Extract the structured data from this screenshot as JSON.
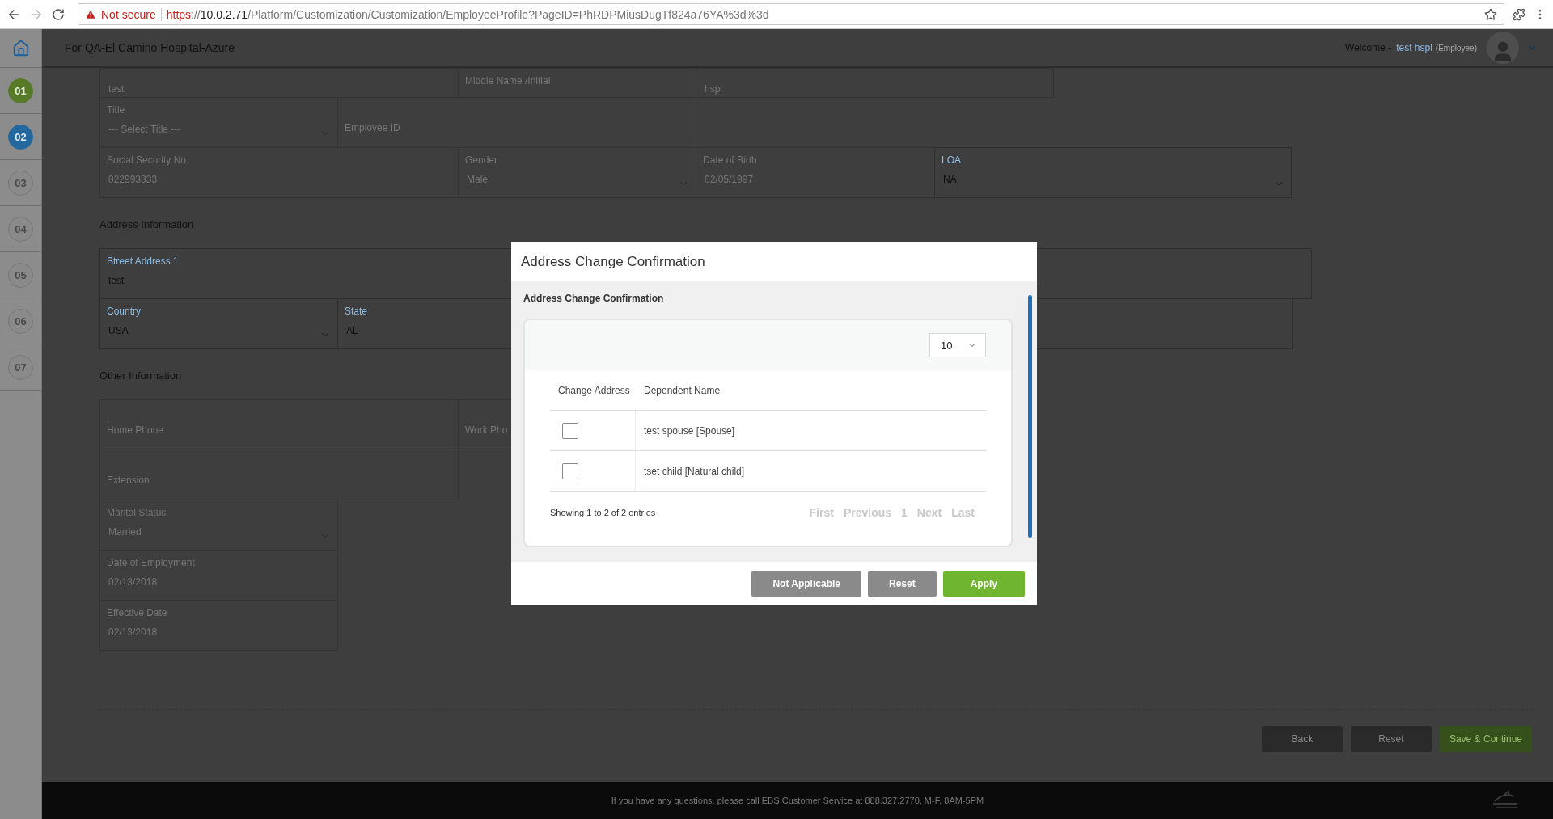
{
  "browser": {
    "security": "Not secure",
    "url_scheme": "https",
    "url_separator": "://",
    "url_host": "10.0.2.71",
    "url_path": "/Platform/Customization/Customization/EmployeeProfile?PageID=PhRDPMiusDugTf824a76YA%3d%3d"
  },
  "header": {
    "title": "For QA-El Camino Hospital-Azure",
    "welcome": "Welcome -",
    "user_name": "test hspl",
    "user_role": "(Employee)"
  },
  "steps": [
    {
      "label": "01",
      "completed": true,
      "selected": false
    },
    {
      "label": "02",
      "completed": false,
      "selected": true
    },
    {
      "label": "03",
      "completed": false,
      "selected": false
    },
    {
      "label": "04",
      "completed": false,
      "selected": false
    },
    {
      "label": "05",
      "completed": false,
      "selected": false
    },
    {
      "label": "06",
      "completed": false,
      "selected": false
    },
    {
      "label": "07",
      "completed": false,
      "selected": false
    }
  ],
  "sections": [
    {
      "rows": [
        [
          {
            "kind": "text",
            "value": "test",
            "disabled": true
          },
          {
            "kind": "text",
            "label": "Middle Name /Initial",
            "disabled": true
          },
          {
            "kind": "text",
            "value": "hspl",
            "disabled": true
          }
        ],
        [
          {
            "kind": "select",
            "label": "Title",
            "value": "--- Select Title ---",
            "disabled": true
          },
          {
            "kind": "text",
            "placeholder": "Employee ID",
            "disabled": true
          }
        ],
        [
          {
            "kind": "text",
            "label": "Social Security No.",
            "value": "022993333",
            "disabled": true
          },
          {
            "kind": "select",
            "label": "Gender",
            "value": "Male",
            "disabled": true
          },
          {
            "kind": "text",
            "label": "Date of Birth",
            "value": "02/05/1997",
            "disabled": true
          },
          {
            "kind": "select",
            "label": "LOA",
            "value": "NA",
            "disabled": false
          }
        ]
      ]
    },
    {
      "title": "Address Information",
      "rows": [
        [
          {
            "kind": "text",
            "label": "Street Address 1",
            "value": "test",
            "disabled": false
          }
        ],
        [
          {
            "kind": "select",
            "label": "Country",
            "value": "USA",
            "disabled": false
          },
          {
            "kind": "text",
            "label": "State",
            "value": "AL",
            "disabled": false
          },
          {
            "kind": "text"
          }
        ]
      ]
    },
    {
      "title": "Other Information",
      "rows": [
        [
          {
            "kind": "text",
            "placeholder": "Home Phone",
            "disabled": true
          },
          {
            "kind": "text",
            "placeholder": "Work Pho",
            "disabled": true
          }
        ],
        [
          {
            "kind": "text",
            "placeholder": "Extension",
            "disabled": true
          }
        ],
        [
          {
            "kind": "select",
            "label": "Marital Status",
            "value": "Married",
            "disabled": true
          }
        ],
        [
          {
            "kind": "text",
            "label": "Date of Employment",
            "value": "02/13/2018",
            "disabled": true
          }
        ],
        [
          {
            "kind": "text",
            "label": "Effective Date",
            "value": "02/13/2018",
            "disabled": true
          }
        ]
      ]
    }
  ],
  "page_buttons": [
    {
      "label": "Back",
      "kind": "secondary"
    },
    {
      "label": "Reset",
      "kind": "secondary"
    },
    {
      "label": "Save & Continue",
      "kind": "primary"
    }
  ],
  "footer": {
    "text": "If you have any questions, please call EBS Customer Service at 888.327.2770, M-F, 8AM-5PM"
  },
  "modal": {
    "title": "Address Change Confirmation",
    "subtitle": "Address Change Confirmation",
    "page_size": "10",
    "columns": [
      "Change Address",
      "Dependent Name"
    ],
    "rows": [
      {
        "checked": false,
        "name": "test spouse [Spouse]"
      },
      {
        "checked": false,
        "name": "tset child [Natural child]"
      }
    ],
    "info": "Showing 1 to 2 of 2 entries",
    "pagination": [
      {
        "label": "First",
        "disabled": true
      },
      {
        "label": "Previous",
        "disabled": true
      },
      {
        "label": "1",
        "disabled": true
      },
      {
        "label": "Next",
        "disabled": true
      },
      {
        "label": "Last",
        "disabled": true
      }
    ],
    "buttons": [
      {
        "label": "Not Applicable",
        "kind": "secondary"
      },
      {
        "label": "Reset",
        "kind": "secondary"
      },
      {
        "label": "Apply",
        "kind": "primary"
      }
    ]
  }
}
